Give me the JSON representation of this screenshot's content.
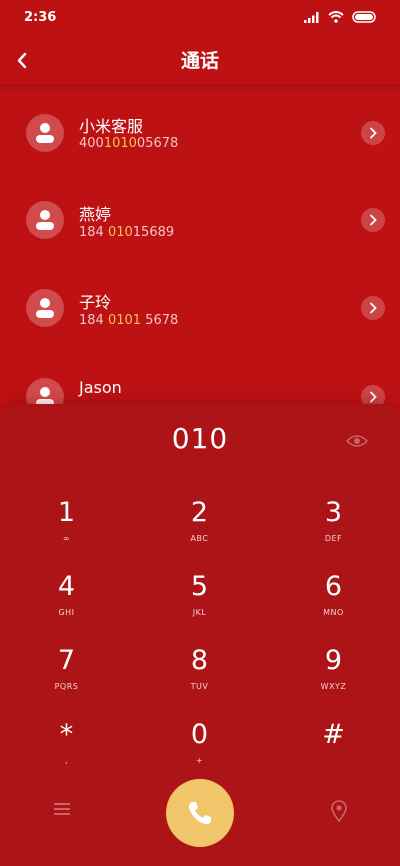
{
  "status_bar": {
    "time": "2:36"
  },
  "header": {
    "title": "通话"
  },
  "contacts": [
    {
      "name": "小米客服",
      "number_parts": [
        "400",
        "1010",
        "05678"
      ]
    },
    {
      "name": "燕婷",
      "number_parts": [
        "184 ",
        "010",
        "15689"
      ]
    },
    {
      "name": "子玲",
      "number_parts": [
        "184 ",
        "0101",
        " 5678"
      ]
    },
    {
      "name": "Jason",
      "number_parts": [
        "",
        "",
        ""
      ]
    }
  ],
  "dial": {
    "number": "010"
  },
  "keys": [
    {
      "digit": "1",
      "sub": "∞"
    },
    {
      "digit": "2",
      "sub": "ABC"
    },
    {
      "digit": "3",
      "sub": "DEF"
    },
    {
      "digit": "4",
      "sub": "GHI"
    },
    {
      "digit": "5",
      "sub": "JKL"
    },
    {
      "digit": "6",
      "sub": "MNO"
    },
    {
      "digit": "7",
      "sub": "PQRS"
    },
    {
      "digit": "8",
      "sub": "TUV"
    },
    {
      "digit": "9",
      "sub": "WXYZ"
    },
    {
      "digit": "*",
      "sub": ","
    },
    {
      "digit": "0",
      "sub": "+"
    },
    {
      "digit": "#",
      "sub": ""
    }
  ],
  "colors": {
    "background": "#bd1114",
    "keypad": "#ac1417",
    "call_button": "#f1c66b",
    "highlight": "#f3c55a"
  },
  "icons": {
    "back": "chevron-left-icon",
    "call": "phone-icon",
    "menu": "menu-icon",
    "pin": "pin-icon"
  }
}
